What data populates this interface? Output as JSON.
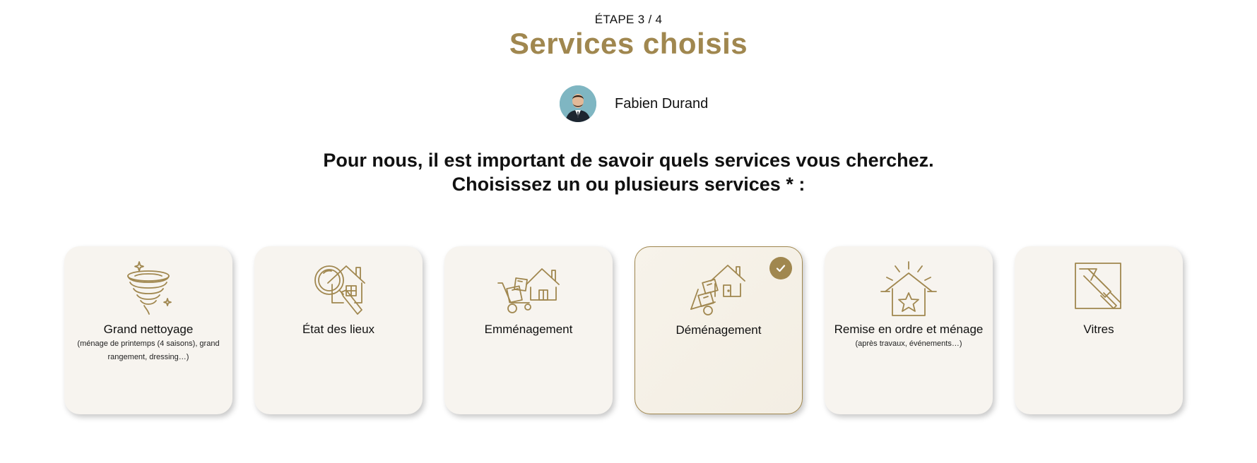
{
  "header": {
    "step": "ÉTAPE 3 / 4",
    "title": "Services choisis"
  },
  "agent": {
    "name": "Fabien Durand"
  },
  "question": {
    "line1": "Pour nous, il est important de savoir quels services vous cherchez.",
    "line2": "Choisissez un ou plusieurs services * :"
  },
  "services": [
    {
      "label": "Grand nettoyage",
      "sub": "(ménage de printemps (4 saisons), grand rangement, dressing…)",
      "icon": "tornado-icon",
      "selected": false
    },
    {
      "label": "État des lieux",
      "sub": "",
      "icon": "house-magnifier-icon",
      "selected": false
    },
    {
      "label": "Emménagement",
      "sub": "",
      "icon": "moving-in-icon",
      "selected": false
    },
    {
      "label": "Déménagement",
      "sub": "",
      "icon": "moving-out-icon",
      "selected": true
    },
    {
      "label": "Remise en ordre et ménage",
      "sub": "(après travaux, événements…)",
      "icon": "house-star-icon",
      "selected": false
    },
    {
      "label": "Vitres",
      "sub": "",
      "icon": "window-squeegee-icon",
      "selected": false
    }
  ],
  "colors": {
    "accent": "#a0874f",
    "card_bg": "#f7f4ef"
  }
}
